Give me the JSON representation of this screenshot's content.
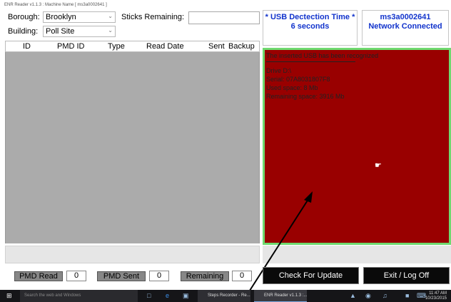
{
  "window": {
    "title": "ENR Reader v1.1.3 : Machine Name [ ms3a0002641 ]"
  },
  "filters": {
    "borough_label": "Borough:",
    "borough_value": "Brooklyn",
    "building_label": "Building:",
    "building_value": "Poll Site",
    "sticks_label": "Sticks Remaining:",
    "sticks_value": ""
  },
  "usb_box": {
    "line1": "* USB Dectection Time *",
    "line2": "6 seconds"
  },
  "network_box": {
    "line1": "ms3a0002641",
    "line2": "Network Connected"
  },
  "table": {
    "headers": [
      "ID",
      "PMD ID",
      "Type",
      "Read Date",
      "Sent",
      "Backup"
    ],
    "rows": []
  },
  "usb_panel": {
    "title": "The inserted USB has been recognized",
    "drive": "Drive D:\\",
    "serial": "Serial: 07A8031807F8",
    "used": "Used space: 8 Mb",
    "remaining": "Remaining space: 3916 Mb"
  },
  "counters": {
    "pmd_read_label": "PMD Read",
    "pmd_read_value": "0",
    "pmd_sent_label": "PMD Sent",
    "pmd_sent_value": "0",
    "remaining_label": "Remaining",
    "remaining_value": "0"
  },
  "buttons": {
    "check_update": "Check For Update",
    "exit": "Exit / Log Off"
  },
  "taskbar": {
    "search_placeholder": "Search the web and Windows",
    "app1": "Steps Recorder - Re...",
    "app2": "ENR Reader v1.1.3 :...",
    "time": "11:47 AM",
    "date": "10/23/2015"
  },
  "colors": {
    "usb_panel_bg": "#990000",
    "usb_panel_border": "#6fd96f",
    "accent_blue": "#1133cc"
  }
}
